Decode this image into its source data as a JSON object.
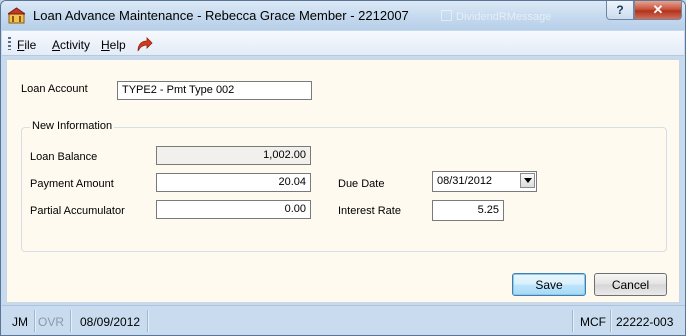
{
  "window": {
    "title": "Loan Advance Maintenance - Rebecca Grace Member - 2212007",
    "ghost_text": "DividendRMessage",
    "help_glyph": "?",
    "close_glyph": "✕",
    "icon": "app-icon"
  },
  "menu": {
    "items": [
      {
        "label": "File",
        "accel": "F",
        "rest": "ile"
      },
      {
        "label": "Activity",
        "accel": "A",
        "rest": "ctivity"
      },
      {
        "label": "Help",
        "accel": "H",
        "rest": "elp"
      }
    ],
    "redo_icon": "redo-arrow-icon"
  },
  "form": {
    "loan_account_label": "Loan Account",
    "loan_account_value": "TYPE2 - Pmt Type 002",
    "group_title": "New Information",
    "loan_balance_label": "Loan Balance",
    "loan_balance_value": "1,002.00",
    "payment_amount_label": "Payment Amount",
    "payment_amount_value": "20.04",
    "partial_accumulator_label": "Partial Accumulator",
    "partial_accumulator_value": "0.00",
    "due_date_label": "Due Date",
    "due_date_value": "08/31/2012",
    "interest_rate_label": "Interest Rate",
    "interest_rate_value": "5.25"
  },
  "buttons": {
    "save": "Save",
    "cancel": "Cancel"
  },
  "status": {
    "user": "JM",
    "ovr": "OVR",
    "date": "08/09/2012",
    "mcf": "MCF",
    "code": "22222-003"
  },
  "colors": {
    "client_bg": "#fefaf0",
    "title_bar": "#c3d8ee",
    "close_button": "#c8553d"
  }
}
